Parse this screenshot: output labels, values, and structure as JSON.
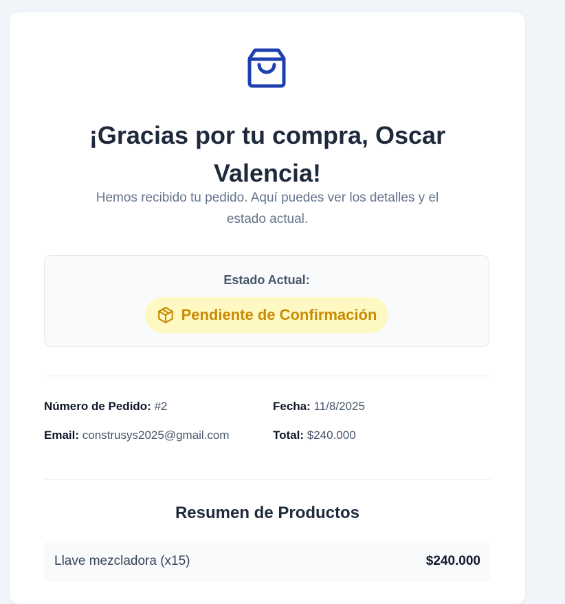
{
  "header": {
    "title": "¡Gracias por tu compra, Oscar Valencia!",
    "subtitle": "Hemos recibido tu pedido. Aquí puedes ver los detalles y el estado actual."
  },
  "status": {
    "label": "Estado Actual:",
    "value": "Pendiente de Confirmación"
  },
  "order": {
    "number_label": "Número de Pedido:",
    "number_value": "#2",
    "date_label": "Fecha:",
    "date_value": "11/8/2025",
    "email_label": "Email:",
    "email_value": "construsys2025@gmail.com",
    "total_label": "Total:",
    "total_value": "$240.000"
  },
  "products": {
    "title": "Resumen de Productos",
    "items": [
      {
        "name": "Llave mezcladora (x15)",
        "price": "$240.000"
      }
    ]
  },
  "icons": {
    "header_icon": "shopping-bag-icon",
    "status_icon": "package-icon"
  },
  "colors": {
    "accent": "#1e40af",
    "status_text": "#ca8a04",
    "status_bg": "#fef9c3"
  }
}
